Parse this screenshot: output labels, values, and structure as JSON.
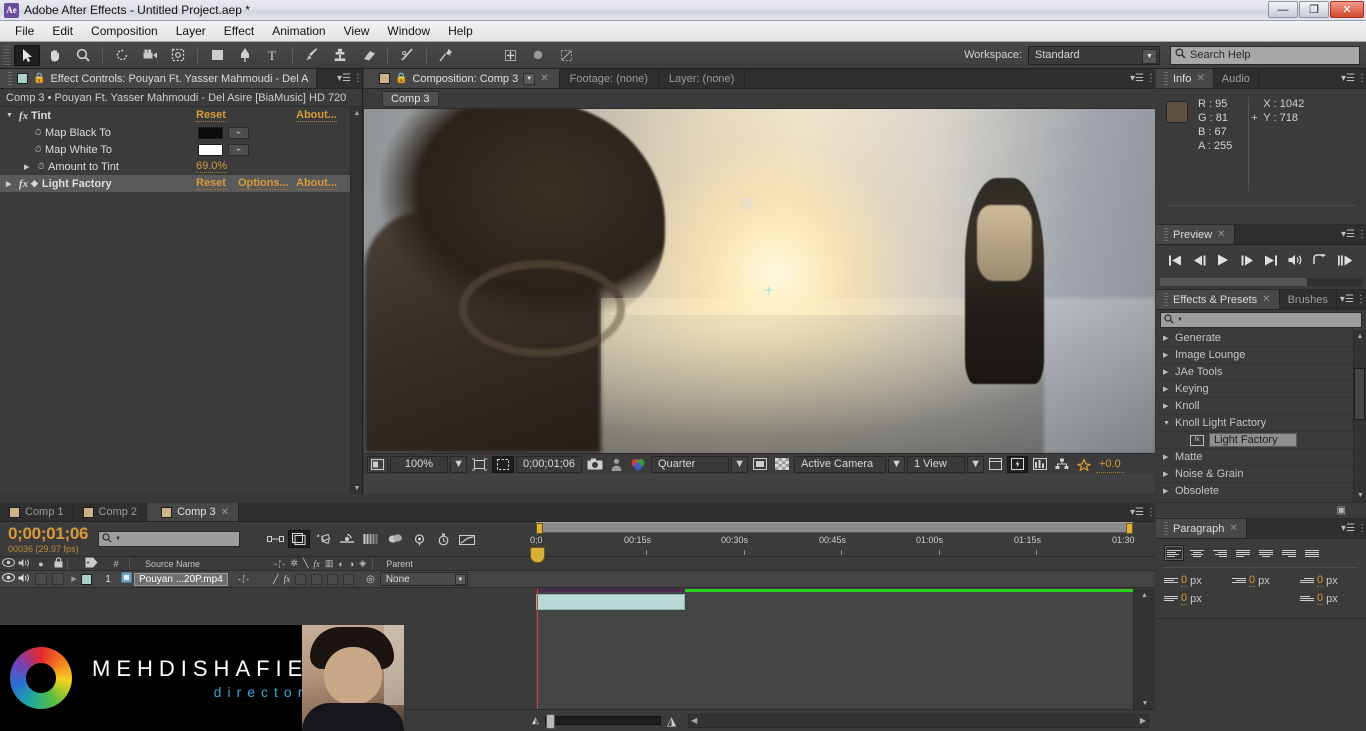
{
  "window": {
    "app_icon": "Ae",
    "title": "Adobe After Effects - Untitled Project.aep *",
    "minimize": "—",
    "restore": "❐",
    "close": "✕"
  },
  "menubar": {
    "items": [
      "File",
      "Edit",
      "Composition",
      "Layer",
      "Effect",
      "Animation",
      "View",
      "Window",
      "Help"
    ]
  },
  "toolbar": {
    "tools": [
      {
        "name": "selection-tool",
        "glyph": "➤",
        "selected": true
      },
      {
        "name": "hand-tool",
        "glyph": "✋",
        "selected": false
      },
      {
        "name": "zoom-tool",
        "glyph": "🔍",
        "selected": false
      },
      {
        "name": "rotation-tool",
        "glyph": "↻",
        "selected": false
      },
      {
        "name": "camera-tool",
        "glyph": "🎥",
        "selected": false
      },
      {
        "name": "pan-behind-tool",
        "glyph": "⛶",
        "selected": false
      },
      {
        "name": "shape-tool",
        "glyph": "▣",
        "selected": false
      },
      {
        "name": "pen-tool",
        "glyph": "✒",
        "selected": false
      },
      {
        "name": "type-tool",
        "glyph": "T",
        "selected": false
      },
      {
        "name": "brush-tool",
        "glyph": "🖌",
        "selected": false
      },
      {
        "name": "clone-stamp-tool",
        "glyph": "♟",
        "selected": false
      },
      {
        "name": "eraser-tool",
        "glyph": "▰",
        "selected": false
      },
      {
        "name": "roto-brush-tool",
        "glyph": "✎",
        "selected": false
      },
      {
        "name": "puppet-pin-tool",
        "glyph": "📌",
        "selected": false
      }
    ],
    "motion_tools": [
      {
        "name": "anchor-point-tool",
        "glyph": "✛"
      },
      {
        "name": "snapping-toggle",
        "glyph": "●"
      },
      {
        "name": "mask-feather-tool",
        "glyph": "◪"
      }
    ],
    "workspace_label": "Workspace:",
    "workspace_value": "Standard",
    "search_placeholder": "Search Help"
  },
  "effect_controls": {
    "tab_title": "Effect Controls: Pouyan Ft. Yasser Mahmoudi -  Del A",
    "subtitle": "Comp 3 • Pouyan Ft. Yasser Mahmoudi -  Del Asire [BiaMusic] HD 720",
    "effects": [
      {
        "name": "Tint",
        "reset": "Reset",
        "about": "About...",
        "expanded": true,
        "properties": [
          {
            "label": "Map Black To",
            "type": "color",
            "value": "#0b0b0b"
          },
          {
            "label": "Map White To",
            "type": "color",
            "value": "#ffffff"
          },
          {
            "label": "Amount to Tint",
            "type": "value",
            "value": "69.0%"
          }
        ]
      },
      {
        "name": "Light Factory",
        "reset": "Reset",
        "options": "Options...",
        "about": "About...",
        "expanded": false,
        "selected": true,
        "properties": []
      }
    ]
  },
  "composition": {
    "tabs": [
      {
        "label": "Composition: Comp 3",
        "active": true,
        "has_dropdown": true,
        "closable": true
      },
      {
        "label": "Footage: (none)",
        "active": false
      },
      {
        "label": "Layer: (none)",
        "active": false
      }
    ],
    "sub_tab": "Comp 3",
    "viewer_controls": {
      "magnification": "100%",
      "timecode": "0;00;01;06",
      "resolution": "Quarter",
      "view_layout": "1 View",
      "camera": "Active Camera",
      "exposure": "+0.0",
      "icons": [
        "always-preview-this-view-icon",
        "region-of-interest-icon",
        "proportional-grid-icon",
        "snapshot-icon",
        "show-snapshot-icon",
        "show-channel-icon",
        "toggle-transparency-grid-icon",
        "toggle-mask-paths-icon",
        "timeline-icon",
        "comp-flowchart-icon",
        "reset-exposure-icon"
      ]
    }
  },
  "info_panel": {
    "tabs": [
      {
        "label": "Info",
        "active": true
      },
      {
        "label": "Audio",
        "active": false
      }
    ],
    "swatch_color": "#5f5143",
    "channels": [
      {
        "label": "R :",
        "value": "95"
      },
      {
        "label": "G :",
        "value": "81"
      },
      {
        "label": "B :",
        "value": "67"
      },
      {
        "label": "A :",
        "value": "255"
      }
    ],
    "coords": [
      {
        "label": "X :",
        "value": "1042"
      },
      {
        "label": "Y :",
        "value": "718"
      }
    ]
  },
  "preview_panel": {
    "tab": "Preview",
    "buttons": [
      {
        "name": "first-frame-button",
        "glyph": "◀|"
      },
      {
        "name": "previous-frame-button",
        "glyph": "◀|"
      },
      {
        "name": "play-button",
        "glyph": "▶"
      },
      {
        "name": "next-frame-button",
        "glyph": "|▶"
      },
      {
        "name": "last-frame-button",
        "glyph": "▶|"
      },
      {
        "name": "audio-toggle-button",
        "glyph": "🔊"
      },
      {
        "name": "loop-button",
        "glyph": "↪"
      },
      {
        "name": "ram-preview-button",
        "glyph": "⏭"
      }
    ]
  },
  "effects_presets": {
    "tabs": [
      {
        "label": "Effects & Presets",
        "active": true
      },
      {
        "label": "Brushes",
        "active": false
      }
    ],
    "search_value": "",
    "categories": [
      {
        "label": "Generate",
        "expanded": false,
        "depth": 0
      },
      {
        "label": "Image Lounge",
        "expanded": false,
        "depth": 0
      },
      {
        "label": "JAe Tools",
        "expanded": false,
        "depth": 0
      },
      {
        "label": "Keying",
        "expanded": false,
        "depth": 0
      },
      {
        "label": "Knoll",
        "expanded": false,
        "depth": 0
      },
      {
        "label": "Knoll Light Factory",
        "expanded": true,
        "depth": 0
      },
      {
        "label": "Light Factory",
        "expanded": null,
        "depth": 1,
        "selected": true
      },
      {
        "label": "Matte",
        "expanded": false,
        "depth": 0
      },
      {
        "label": "Noise & Grain",
        "expanded": false,
        "depth": 0
      },
      {
        "label": "Obsolete",
        "expanded": false,
        "depth": 0
      }
    ]
  },
  "paragraph_panel": {
    "tab": "Paragraph",
    "align_buttons": [
      {
        "name": "align-left-button",
        "selected": true
      },
      {
        "name": "align-center-button",
        "selected": false
      },
      {
        "name": "align-right-button",
        "selected": false
      },
      {
        "name": "justify-last-left-button",
        "selected": false
      },
      {
        "name": "justify-last-center-button",
        "selected": false
      },
      {
        "name": "justify-last-right-button",
        "selected": false
      },
      {
        "name": "justify-all-button",
        "selected": false
      }
    ],
    "fields": [
      {
        "name": "indent-left-margin",
        "value": "0",
        "unit": "px"
      },
      {
        "name": "indent-right-margin",
        "value": "0",
        "unit": "px"
      },
      {
        "name": "indent-first-line",
        "value": "0",
        "unit": "px"
      },
      {
        "name": "space-before-paragraph",
        "value": "0",
        "unit": "px"
      },
      {
        "name": "space-after-paragraph",
        "value": "0",
        "unit": "px"
      }
    ]
  },
  "timeline": {
    "tabs": [
      {
        "label": "Comp 1",
        "active": false
      },
      {
        "label": "Comp 2",
        "active": false
      },
      {
        "label": "Comp 3",
        "active": true
      }
    ],
    "current_time": "0;00;01;06",
    "frame_info": "00036 (29.97 fps)",
    "search_value": "",
    "switch_icons": [
      "composition-mini-flowchart-icon",
      "draft-3d-icon",
      "hide-shy-layers-icon",
      "enable-frame-blending-icon",
      "enable-motion-blur-icon",
      "brainstorm-icon",
      "graph-editor-icon",
      "auto-keyframe-icon",
      "motion-blur-icon"
    ],
    "columns": [
      "Source Name",
      "Parent"
    ],
    "layers": [
      {
        "index": "1",
        "source_name": "Pouyan ...20P.mp4",
        "parent": "None",
        "video_on": true,
        "audio_on": true,
        "label_color": "#a8cfc9",
        "bar_start_pct": 0,
        "bar_end_pct": 25
      }
    ],
    "ruler_ticks": [
      "00:15s",
      "00:30s",
      "00:45s",
      "01:00s",
      "01:15s",
      "01:30"
    ],
    "ruler_start": "0;0",
    "work_area_green_start_pct": 25,
    "zoom_level": 0.07
  },
  "watermark": {
    "brand": "MEHDISHAFIE",
    "role": "director"
  }
}
